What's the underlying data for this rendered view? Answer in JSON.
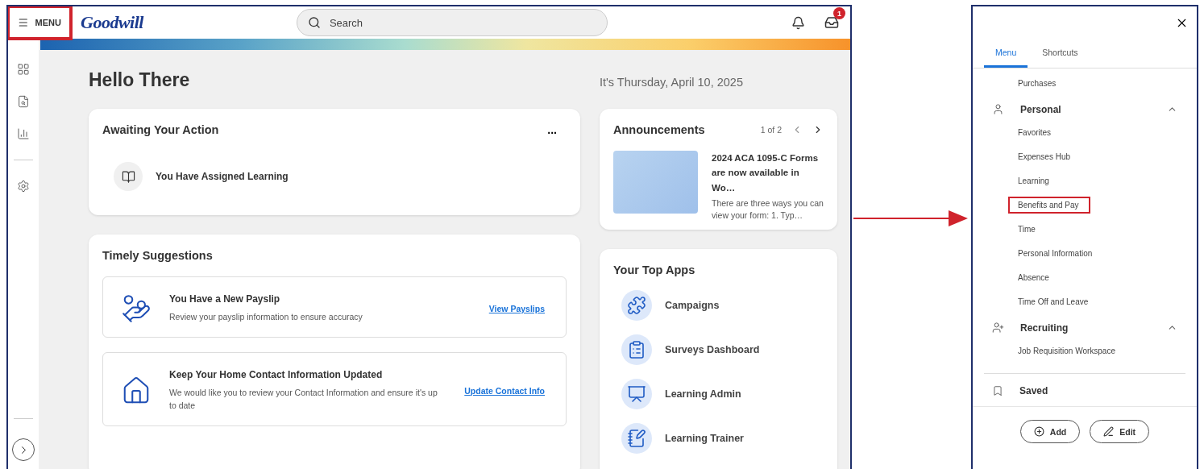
{
  "header": {
    "menu_button": {
      "label": "MENU",
      "highlighted": true
    },
    "logo": "Goodwill",
    "search": {
      "placeholder": "Search"
    },
    "inbox_badge": "1"
  },
  "greeting": {
    "title": "Hello There",
    "date": "It's Thursday, April 10, 2025"
  },
  "awaiting": {
    "title": "Awaiting Your Action",
    "more": "...",
    "items": [
      {
        "label": "You Have Assigned Learning"
      }
    ]
  },
  "suggestions": {
    "title": "Timely Suggestions",
    "items": [
      {
        "title": "You Have a New Payslip",
        "text": "Review your payslip information to ensure accuracy",
        "link": "View Payslips"
      },
      {
        "title": "Keep Your Home Contact Information Updated",
        "text": "We would like you to review your Contact Information and ensure it's up to date",
        "link": "Update Contact Info"
      }
    ]
  },
  "announcements": {
    "title": "Announcements",
    "pager": "1 of 2",
    "items": [
      {
        "title": "2024 ACA 1095-C Forms are now available in Wo…",
        "text": "There are three ways you can view your form: 1. Typ…"
      }
    ]
  },
  "top_apps": {
    "title": "Your Top Apps",
    "items": [
      {
        "label": "Campaigns"
      },
      {
        "label": "Surveys Dashboard"
      },
      {
        "label": "Learning Admin"
      },
      {
        "label": "Learning Trainer"
      }
    ]
  },
  "menu_panel": {
    "tabs": [
      {
        "label": "Menu",
        "selected": true
      },
      {
        "label": "Shortcuts",
        "selected": false
      }
    ],
    "items": [
      {
        "kind": "link",
        "label": "Purchases",
        "highlighted": false
      },
      {
        "kind": "section",
        "label": "Personal",
        "expanded": true,
        "children": [
          {
            "kind": "link",
            "label": "Favorites",
            "highlighted": false
          },
          {
            "kind": "link",
            "label": "Expenses Hub",
            "highlighted": false
          },
          {
            "kind": "link",
            "label": "Learning",
            "highlighted": false
          },
          {
            "kind": "link",
            "label": "Benefits and Pay",
            "highlighted": true
          },
          {
            "kind": "link",
            "label": "Time",
            "highlighted": false
          },
          {
            "kind": "link",
            "label": "Personal Information",
            "highlighted": false
          },
          {
            "kind": "link",
            "label": "Absence",
            "highlighted": false
          },
          {
            "kind": "link",
            "label": "Time Off and Leave",
            "highlighted": false
          }
        ]
      },
      {
        "kind": "section",
        "label": "Recruiting",
        "expanded": true,
        "children": [
          {
            "kind": "link",
            "label": "Job Requisition Workspace",
            "highlighted": false
          }
        ]
      }
    ],
    "saved": "Saved",
    "buttons": [
      {
        "kind": "add",
        "label": "Add"
      },
      {
        "kind": "edit",
        "label": "Edit"
      }
    ]
  }
}
